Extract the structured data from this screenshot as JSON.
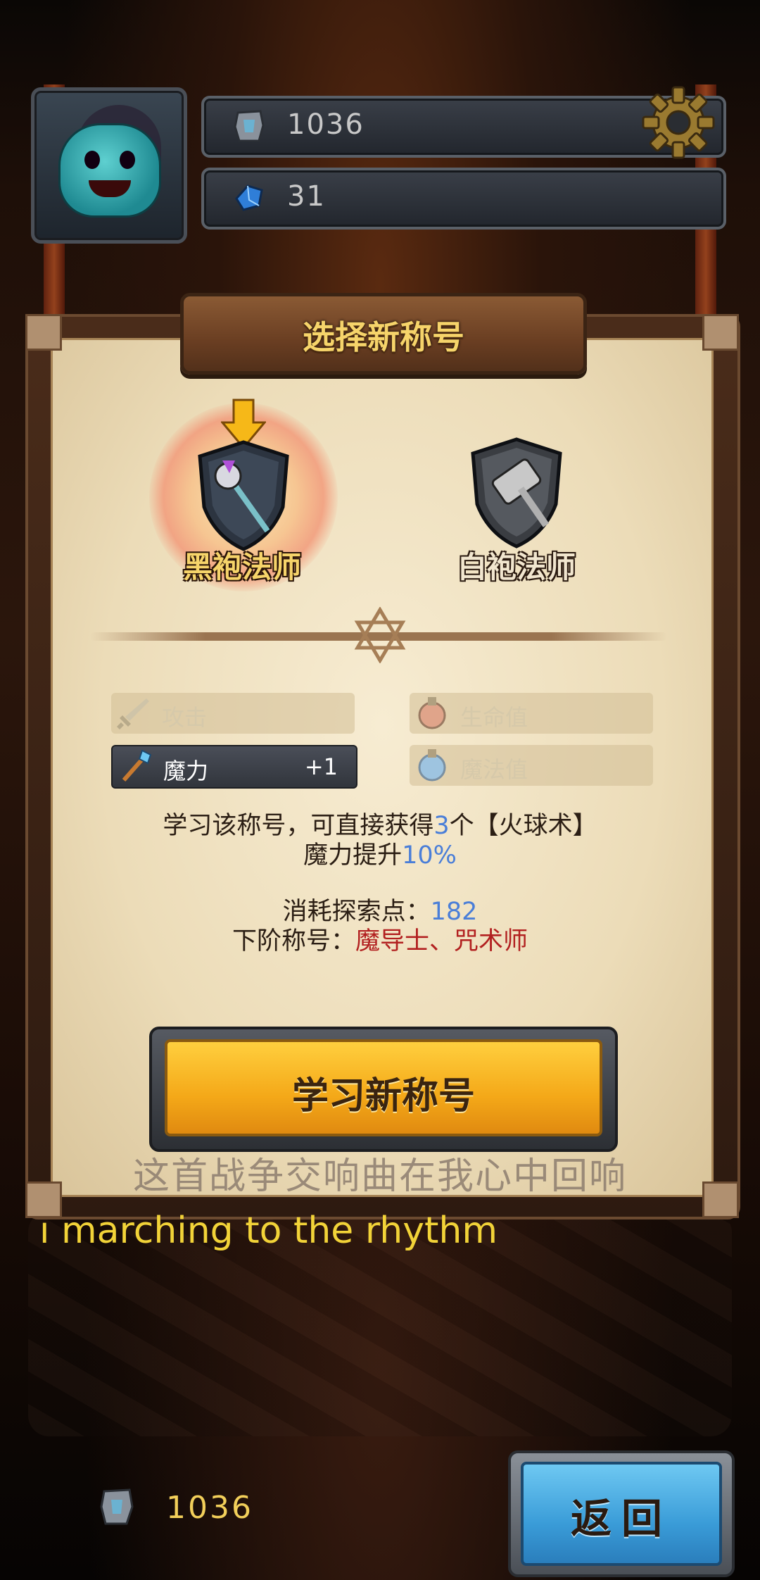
{
  "hud": {
    "stones": "1036",
    "gems": "31",
    "stone_icon": "rune-stone-icon",
    "gem_icon": "blue-crystal-icon",
    "settings_icon": "gear-icon"
  },
  "panel": {
    "title": "选择新称号",
    "titles": [
      {
        "label": "黑袍法师",
        "state": "selected",
        "icon": "dark-staff-shield-icon"
      },
      {
        "label": "白袍法师",
        "state": "unselected",
        "icon": "hammer-shield-icon"
      }
    ],
    "stats": [
      {
        "label": "攻击",
        "bonus": "",
        "enabled": false,
        "icon": "sword-icon"
      },
      {
        "label": "生命值",
        "bonus": "",
        "enabled": false,
        "icon": "red-potion-icon"
      },
      {
        "label": "魔力",
        "bonus": "+1",
        "enabled": true,
        "icon": "magic-staff-icon"
      },
      {
        "label": "魔法值",
        "bonus": "",
        "enabled": false,
        "icon": "blue-potion-icon"
      }
    ],
    "desc": {
      "line1_pre": "学习该称号，可直接获得",
      "line1_num": "3",
      "line1_post": "个【火球术】",
      "line2_pre": "魔力提升",
      "line2_num": "10%",
      "cost_label": "消耗探索点：",
      "cost_value": "182",
      "next_label": "下阶称号：",
      "next_value": "魔导士、咒术师"
    },
    "learn_button": "学习新称号"
  },
  "subtitles": {
    "cn": "这首战争交响曲在我心中回响",
    "en": "ı marching to the rhythm"
  },
  "footer": {
    "stones": "1036",
    "back_button": "返回"
  },
  "colors": {
    "accent_blue": "#4a7ed8",
    "accent_red": "#b22020",
    "gold": "#f6d46a"
  }
}
